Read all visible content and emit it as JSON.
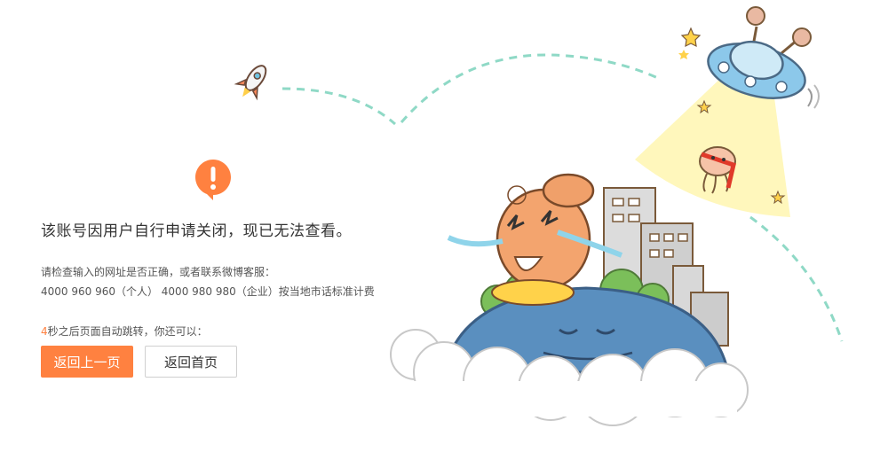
{
  "message": {
    "title": "该账号因用户自行申请关闭，现已无法查看。",
    "hint_line1": "请检查输入的网址是否正确，或者联系微博客服：",
    "hint_line2": "4000 960 960（个人） 4000 980 980（企业）按当地市话标准计费"
  },
  "countdown": {
    "seconds": "4",
    "text": "秒之后页面自动跳转，你还可以："
  },
  "buttons": {
    "back_label": "返回上一页",
    "home_label": "返回首页"
  },
  "icons": {
    "alert": "exclamation-icon",
    "illustration": "sad-mascot-city-ufo-illustration"
  },
  "colors": {
    "accent": "#ff8140",
    "title_text": "#333333",
    "body_text": "#555555",
    "dash_path": "#8fd9c6"
  }
}
